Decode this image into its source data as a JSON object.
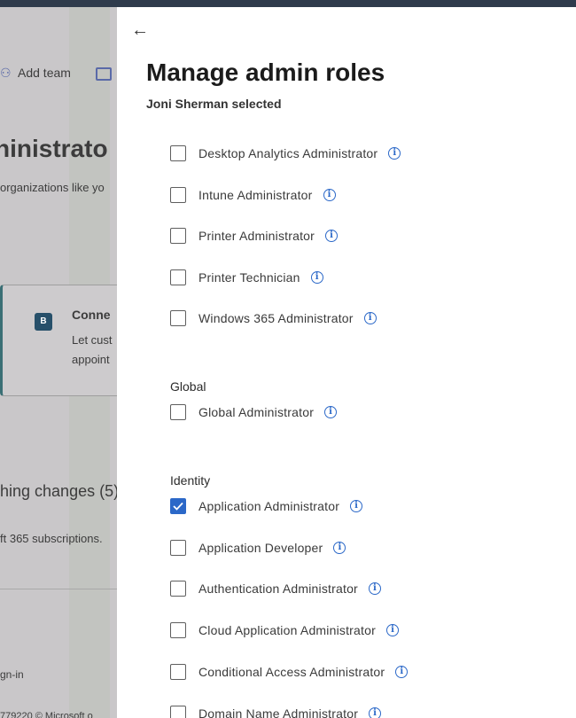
{
  "background": {
    "add_team": "Add team",
    "heading": "ninistrato",
    "subtext": "organizations like yo",
    "card_title": "Conne",
    "card_line1": "Let cust",
    "card_line2": "appoint",
    "card_logo": "B",
    "pending": "hing changes (5)",
    "subscriptions": "ft 365 subscriptions.",
    "signin": "gn-in",
    "footer": "779220 © Microsoft o"
  },
  "panel": {
    "title": "Manage admin roles",
    "subtitle": "Joni Sherman selected",
    "sections": [
      {
        "heading": "",
        "roles": [
          {
            "label": "Desktop Analytics Administrator",
            "checked": false
          },
          {
            "label": "Intune Administrator",
            "checked": false
          },
          {
            "label": "Printer Administrator",
            "checked": false
          },
          {
            "label": "Printer Technician",
            "checked": false
          },
          {
            "label": "Windows 365 Administrator",
            "checked": false
          }
        ]
      },
      {
        "heading": "Global",
        "roles": [
          {
            "label": "Global Administrator",
            "checked": false
          }
        ]
      },
      {
        "heading": "Identity",
        "roles": [
          {
            "label": "Application Administrator",
            "checked": true
          },
          {
            "label": "Application Developer",
            "checked": false
          },
          {
            "label": "Authentication Administrator",
            "checked": false
          },
          {
            "label": "Cloud Application Administrator",
            "checked": false
          },
          {
            "label": "Conditional Access Administrator",
            "checked": false
          },
          {
            "label": "Domain Name Administrator",
            "checked": false
          }
        ]
      }
    ]
  },
  "colors": {
    "accent": "#2b68c8",
    "overlay": "#c9c7c9",
    "topbar": "#2f3b4c"
  }
}
